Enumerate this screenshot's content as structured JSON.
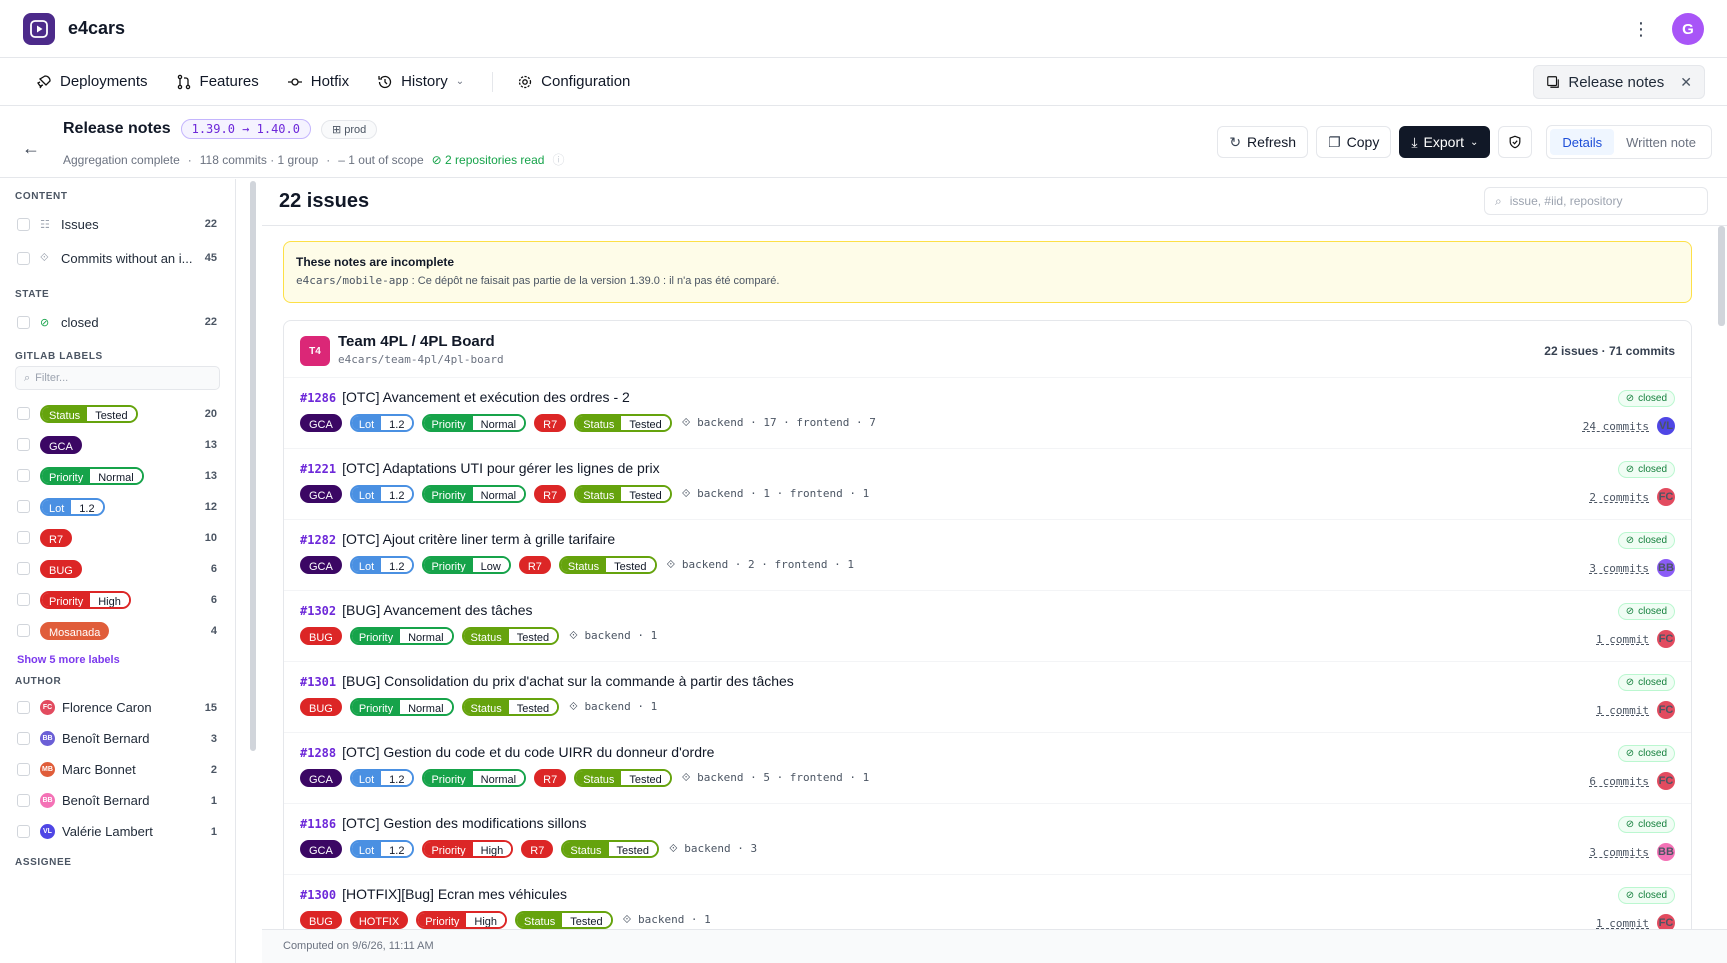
{
  "app": {
    "name": "e4cars",
    "user_initial": "G"
  },
  "colors": {
    "accent": "#7c3aed",
    "gca": "#3b0764",
    "lot": "#4a90e2",
    "priority": "#16a34a",
    "r7": "#dc2626",
    "status": "#65a30d",
    "bug": "#dc2626",
    "high": "#dc2626",
    "mosanada": "#e05d3a",
    "hotfix": "#dc2626"
  },
  "nav": {
    "deployments": "Deployments",
    "features": "Features",
    "hotfix": "Hotfix",
    "history": "History",
    "configuration": "Configuration",
    "release_notes_tab": "Release notes"
  },
  "header": {
    "title": "Release notes",
    "version": "1.39.0 → 1.40.0",
    "env": "prod",
    "status": "Aggregation complete",
    "commits": "118 commits · 1 group",
    "scope": "1 out of scope",
    "repos": "2 repositories read"
  },
  "actions": {
    "refresh": "Refresh",
    "copy": "Copy",
    "export": "Export",
    "details": "Details",
    "written": "Written note"
  },
  "sidebar": {
    "content_title": "CONTENT",
    "issues": "Issues",
    "issues_count": "22",
    "commits": "Commits without an i...",
    "commits_count": "45",
    "state_title": "STATE",
    "closed": "closed",
    "closed_count": "22",
    "labels_title": "GITLAB LABELS",
    "filter_placeholder": "Filter...",
    "show_more": "Show 5 more labels",
    "label_counts": [
      "20",
      "13",
      "13",
      "12",
      "10",
      "6",
      "6",
      "4"
    ],
    "author_title": "AUTHOR",
    "authors": [
      {
        "name": "Florence Caron",
        "count": "15",
        "init": "FC"
      },
      {
        "name": "Benoît Bernard",
        "count": "3",
        "init": "BB"
      },
      {
        "name": "Marc Bonnet",
        "count": "2",
        "init": "MB"
      },
      {
        "name": "Benoît Bernard",
        "count": "1",
        "init": "BB"
      },
      {
        "name": "Valérie Lambert",
        "count": "1",
        "init": "VL"
      }
    ],
    "assignee_title": "ASSIGNEE"
  },
  "labels": {
    "status": "Status",
    "tested": "Tested",
    "gca": "GCA",
    "priority": "Priority",
    "normal": "Normal",
    "low": "Low",
    "high": "High",
    "lot": "Lot",
    "lot_v": "1.2",
    "r7": "R7",
    "bug": "BUG",
    "mosanada": "Mosanada",
    "hotfix": "HOTFIX"
  },
  "main": {
    "count": "22 issues",
    "search_placeholder": "issue, #iid, repository",
    "alert_title": "These notes are incomplete",
    "alert_repo": "e4cars/mobile-app",
    "alert_body": " : Ce dépôt ne faisait pas partie de la version 1.39.0 : il n'a pas été comparé.",
    "team": "Team 4PL / 4PL Board",
    "team_init": "T4",
    "team_path": "e4cars/team-4pl/4pl-board",
    "team_stats": "22 issues · 71 commits",
    "closed_label": "closed",
    "issues": [
      {
        "id": "#1286",
        "title": "[OTC] Avancement et exécution des ordres - 2",
        "comps": "backend · 17 · frontend · 7",
        "commits": "24 commits",
        "av": "VL"
      },
      {
        "id": "#1221",
        "title": "[OTC] Adaptations UTI pour gérer les lignes de prix",
        "comps": "backend · 1 · frontend · 1",
        "commits": "2 commits",
        "av": "FC"
      },
      {
        "id": "#1282",
        "title": "[OTC] Ajout critère liner term à grille tarifaire",
        "comps": "backend · 2 · frontend · 1",
        "commits": "3 commits",
        "av": "BB"
      },
      {
        "id": "#1302",
        "title": "[BUG] Avancement des tâches",
        "comps": "backend · 1",
        "commits": "1 commit",
        "av": "FC"
      },
      {
        "id": "#1301",
        "title": "[BUG] Consolidation du prix d'achat sur la commande à partir des tâches",
        "comps": "backend · 1",
        "commits": "1 commit",
        "av": "FC"
      },
      {
        "id": "#1288",
        "title": "[OTC] Gestion du code et du code UIRR du donneur d'ordre",
        "comps": "backend · 5 · frontend · 1",
        "commits": "6 commits",
        "av": "FC"
      },
      {
        "id": "#1186",
        "title": "[OTC] Gestion des modifications sillons",
        "comps": "backend · 3",
        "commits": "3 commits",
        "av": "BB"
      },
      {
        "id": "#1300",
        "title": "[HOTFIX][Bug] Ecran mes véhicules",
        "comps": "backend · 1",
        "commits": "1 commit",
        "av": "FC"
      }
    ],
    "footer": "Computed on 9/6/26, 11:11 AM"
  }
}
